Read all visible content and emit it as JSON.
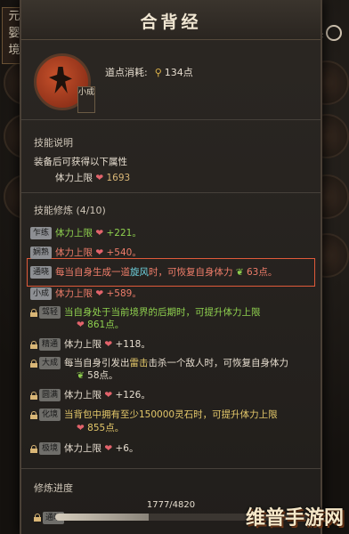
{
  "left_tag": [
    "元",
    "婴",
    "境"
  ],
  "right_tag": {
    "c1": "心",
    "c2": "法"
  },
  "title": "合背经",
  "avatar_badge": "小成",
  "cost": {
    "label": "道点消耗:",
    "value": "134点"
  },
  "skill_desc": {
    "heading": "技能说明",
    "line1": "装备后可获得以下属性",
    "attr_label": "体力上限",
    "attr_value": "1693"
  },
  "cultivation": {
    "heading": "技能修炼 (4/10)",
    "rows": [
      {
        "tag": "乍练",
        "text": "体力上限",
        "value": "+221。",
        "style": "green"
      },
      {
        "tag": "娴熟",
        "text": "体力上限",
        "value": "+540。",
        "style": "red"
      },
      {
        "tag": "通晓",
        "text_a": "每当自身生成一道",
        "keyword": "旋风",
        "text_b": "时，可恢复自身体力",
        "value": "63点。",
        "style": "red"
      },
      {
        "tag": "小成",
        "text": "体力上限",
        "value": "+589。",
        "style": "red"
      },
      {
        "tag": "驾轻",
        "text_a": "当自身处于当前境界的后期时，可提升体力上限",
        "value": "861点。",
        "style": "green"
      },
      {
        "tag": "精通",
        "text": "体力上限",
        "value": "+118。",
        "style": "white"
      },
      {
        "tag": "大成",
        "text_a": "每当自身引发出",
        "keyword": "雷击",
        "text_b": "击杀一个敌人时，可恢复自身体力",
        "value": "58点。",
        "style": "white"
      },
      {
        "tag": "圆满",
        "text": "体力上限",
        "value": "+126。",
        "style": "white"
      },
      {
        "tag": "化境",
        "text_a": "当背包中拥有至少150000灵石时，可提升体力上限",
        "value": "855点。",
        "style": "yellow"
      },
      {
        "tag": "极境",
        "text": "体力上限",
        "value": "+6。",
        "style": "white"
      }
    ]
  },
  "progress": {
    "heading": "修炼进度",
    "label": "1777/4820",
    "tag": "通晓",
    "fraction": 0.369
  },
  "watermark": "维普手游网",
  "colors": {
    "accent": "#e05a3a",
    "heart": "#e2636b",
    "green": "#8fd14f",
    "yellow": "#e4c86a"
  }
}
